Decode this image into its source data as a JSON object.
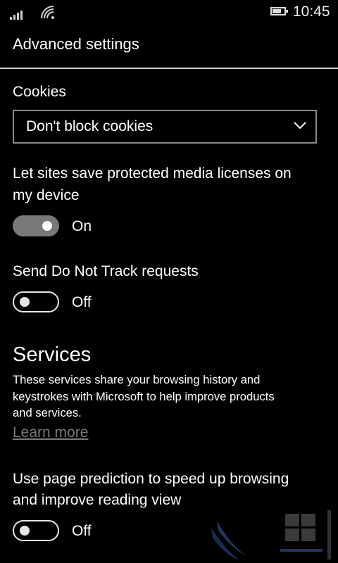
{
  "status_bar": {
    "time": "10:45",
    "battery_level": 0.75,
    "icons": [
      "signal-bars-icon",
      "wifi-icon",
      "battery-icon"
    ]
  },
  "page": {
    "title": "Advanced settings"
  },
  "cookies": {
    "label": "Cookies",
    "selected": "Don't block cookies"
  },
  "media_licenses": {
    "label_line1": "Let sites save protected media licenses on",
    "label_line2": "my device",
    "state": "On",
    "enabled": true
  },
  "do_not_track": {
    "label": "Send Do Not Track requests",
    "state": "Off",
    "enabled": false
  },
  "services": {
    "title": "Services",
    "description_line1": "These services share your browsing history and",
    "description_line2": "keystrokes with Microsoft to help improve products",
    "description_line3": "and services.",
    "learn_more": "Learn more"
  },
  "page_prediction": {
    "label_line1": "Use page prediction to speed up browsing",
    "label_line2": "and improve reading view",
    "state": "Off",
    "enabled": false
  },
  "colors": {
    "background": "#000000",
    "toggle_on": "#7a7778",
    "link": "#7a7a7a"
  }
}
